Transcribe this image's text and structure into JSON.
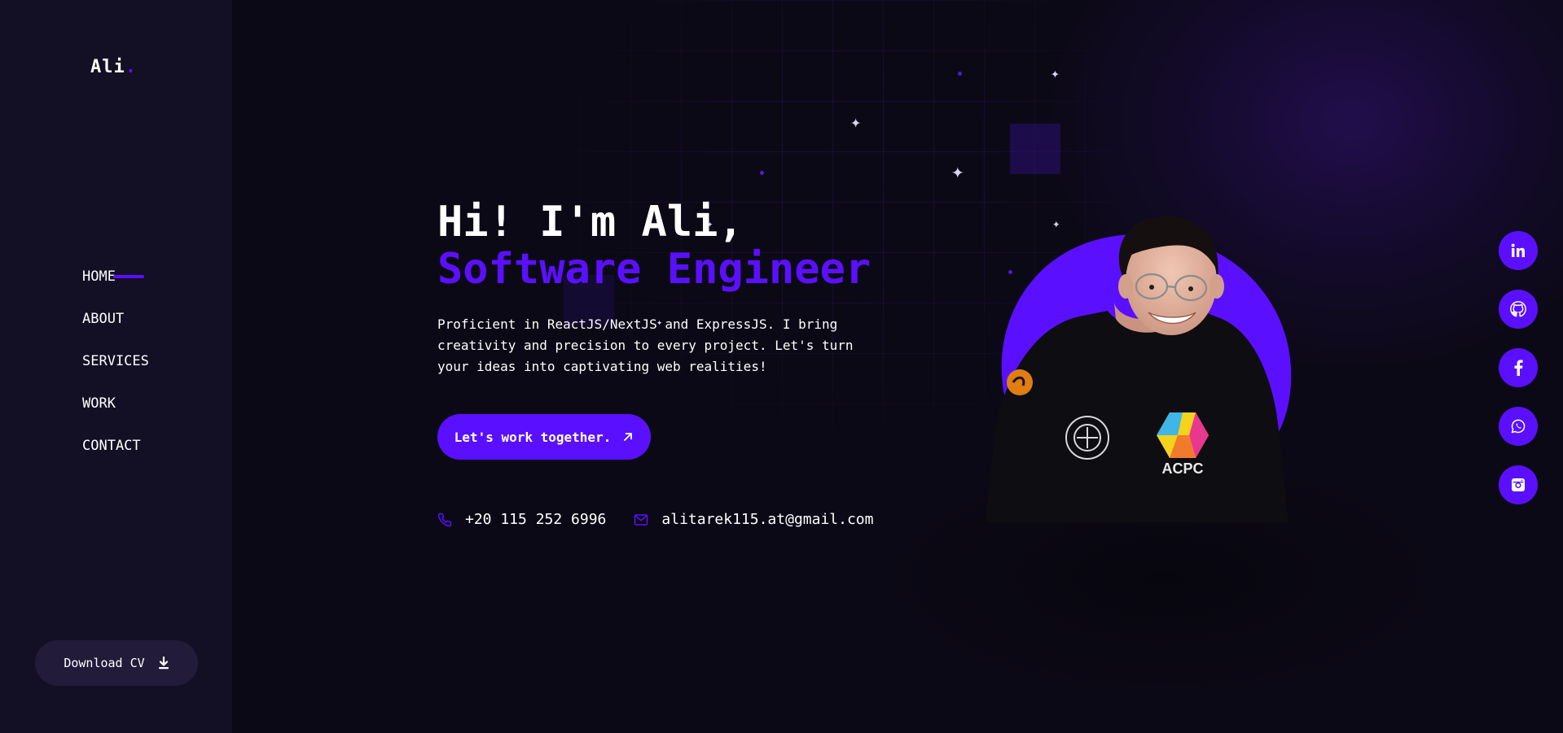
{
  "brand": {
    "name": "Ali",
    "dot": ".",
    "accent": "#5a10ff"
  },
  "nav": {
    "items": [
      {
        "label": "HOME",
        "active": true
      },
      {
        "label": "ABOUT",
        "active": false
      },
      {
        "label": "SERVICES",
        "active": false
      },
      {
        "label": "WORK",
        "active": false
      },
      {
        "label": "CONTACT",
        "active": false
      }
    ]
  },
  "sidebar": {
    "download_cv_label": "Download CV",
    "download_icon": "download-icon"
  },
  "hero": {
    "greeting": "Hi! I'm Ali,",
    "role": "Software Engineer",
    "description": "Proficient in ReactJS/NextJS and ExpressJS. I bring creativity and precision to every project. Let's turn your ideas into captivating web realities!",
    "cta_label": "Let's work together.",
    "cta_icon": "arrow-up-right-icon"
  },
  "contact": {
    "phone": "+20 115 252 6996",
    "phone_icon": "phone-icon",
    "email": "alitarek115.at@gmail.com",
    "email_icon": "mail-icon"
  },
  "social": [
    {
      "name": "linkedin",
      "icon": "linkedin-icon"
    },
    {
      "name": "github",
      "icon": "github-icon"
    },
    {
      "name": "facebook",
      "icon": "facebook-icon"
    },
    {
      "name": "whatsapp",
      "icon": "whatsapp-icon"
    },
    {
      "name": "instagram",
      "icon": "instagram-icon"
    }
  ],
  "profile_photo": {
    "icon": "profile-photo",
    "shirt_text": "ACPC"
  },
  "colors": {
    "background": "#0c0916",
    "sidebar": "#130f24",
    "accent": "#5a10ff",
    "button_dark": "#221c3a"
  }
}
